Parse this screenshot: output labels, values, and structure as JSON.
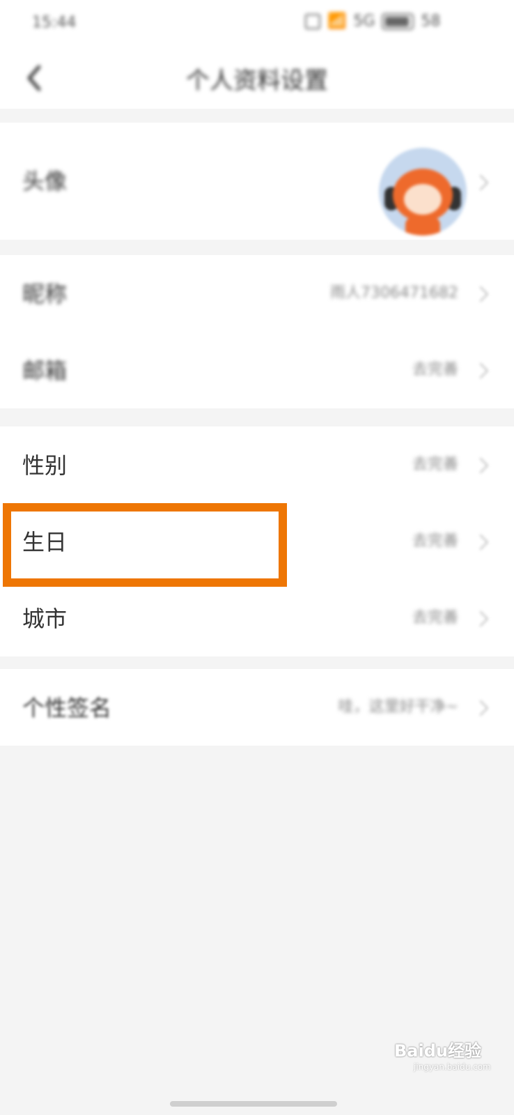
{
  "status_bar": {
    "time": "15:44",
    "signal_text": "5G",
    "battery": "58"
  },
  "header": {
    "title": "个人资料设置"
  },
  "profile": {
    "avatar_label": "头像",
    "nickname_label": "昵称",
    "nickname_value": "雨人7306471682",
    "email_label": "邮箱",
    "email_value": "去完善",
    "gender_label": "性别",
    "gender_value": "去完善",
    "birthday_label": "生日",
    "birthday_value": "去完善",
    "city_label": "城市",
    "city_value": "去完善",
    "signature_label": "个性签名",
    "signature_value": "哇，这里好干净~"
  },
  "highlight_color": "#ee7604",
  "watermark": {
    "brand": "Baidu经验",
    "url": "jingyan.baidu.com"
  }
}
